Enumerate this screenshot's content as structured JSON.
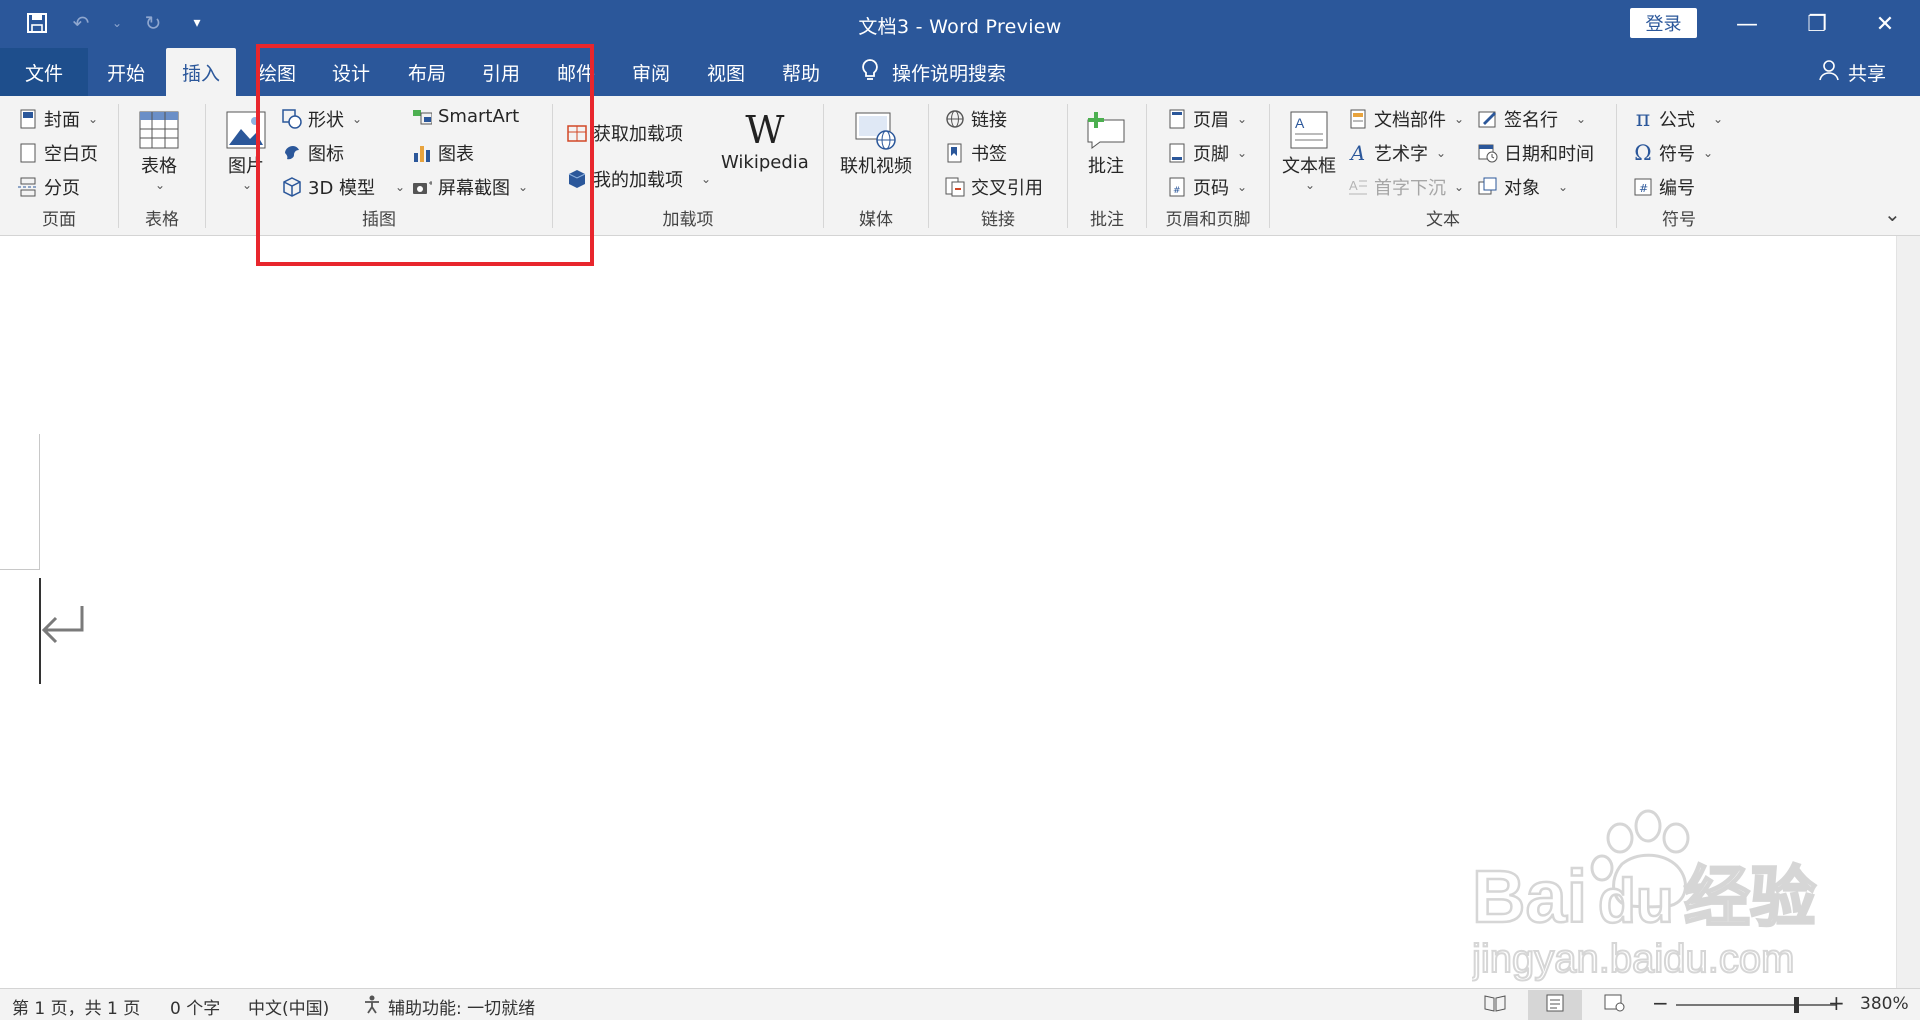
{
  "titlebar": {
    "doc_title": "文档3  -  Word Preview",
    "login": "登录",
    "minimize_glyph": "—",
    "restore_glyph": "❐",
    "close_glyph": "✕"
  },
  "tabs": {
    "file": "文件",
    "home": "开始",
    "insert": "插入",
    "draw": "绘图",
    "design": "设计",
    "layout": "布局",
    "references": "引用",
    "mailings": "邮件",
    "review": "审阅",
    "view": "视图",
    "help": "帮助",
    "tell_me": "操作说明搜索",
    "share": "共享"
  },
  "ribbon": {
    "pages": {
      "label": "页面",
      "cover": "封面",
      "blank": "空白页",
      "break": "分页"
    },
    "tables": {
      "label": "表格",
      "table": "表格"
    },
    "illustrations": {
      "label": "插图",
      "pictures": "图片",
      "shapes": "形状",
      "icons": "图标",
      "model3d": "3D 模型",
      "smartart": "SmartArt",
      "chart": "图表",
      "screenshot": "屏幕截图"
    },
    "addins": {
      "label": "加载项",
      "get": "获取加载项",
      "my": "我的加载项",
      "wikipedia": "Wikipedia"
    },
    "media": {
      "label": "媒体",
      "video": "联机视频"
    },
    "links": {
      "label": "链接",
      "link": "链接",
      "bookmark": "书签",
      "crossref": "交叉引用"
    },
    "comments": {
      "label": "批注",
      "comment": "批注"
    },
    "header_footer": {
      "label": "页眉和页脚",
      "header": "页眉",
      "footer": "页脚",
      "page_number": "页码"
    },
    "text": {
      "label": "文本",
      "textbox": "文本框",
      "quick_parts": "文档部件",
      "wordart": "艺术字",
      "dropcap": "首字下沉",
      "signature": "签名行",
      "datetime": "日期和时间",
      "object": "对象"
    },
    "symbols": {
      "label": "符号",
      "equation": "公式",
      "symbol": "符号",
      "number": "编号"
    }
  },
  "statusbar": {
    "page": "第 1 页，共 1 页",
    "words": "0 个字",
    "language": "中文(中国)",
    "accessibility": "辅助功能: 一切就绪",
    "zoom_minus": "−",
    "zoom_plus": "+",
    "zoom": "380%",
    "zoom_fraction": 0.75
  },
  "watermark": {
    "brand": "Bai",
    "brand2": "du",
    "cn": "经验",
    "url": "jingyan.baidu.com"
  },
  "colors": {
    "accent": "#2b579a",
    "highlight": "#e8262d"
  }
}
